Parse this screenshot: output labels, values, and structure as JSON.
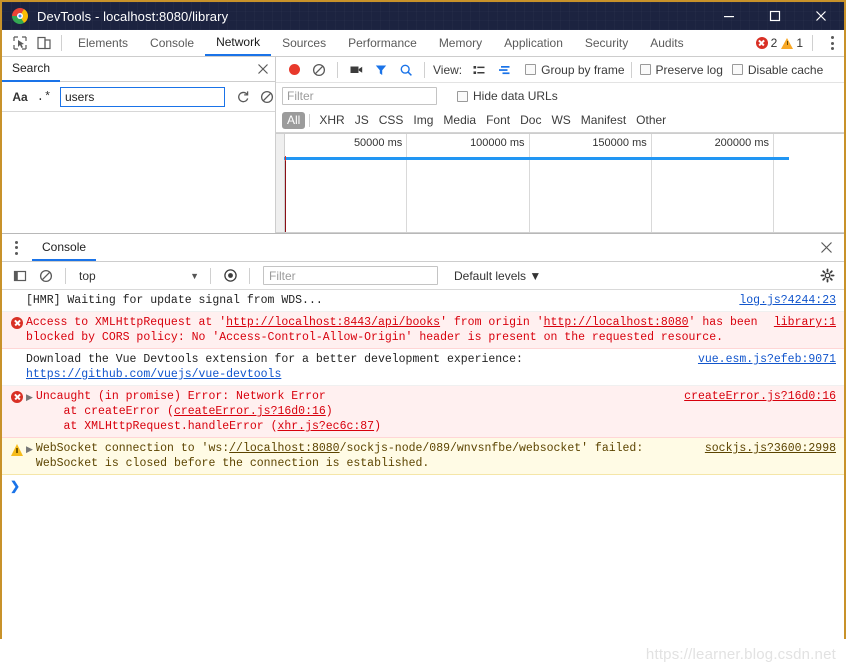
{
  "window": {
    "title": "DevTools - localhost:8080/library",
    "logo": "chrome-logo",
    "minimize": "–",
    "maximize": "□",
    "close": "✕"
  },
  "devtools_tabs": {
    "inspect_icon": "inspect-cursor-icon",
    "device_icon": "device-toolbar-icon",
    "items": [
      {
        "label": "Elements",
        "active": false
      },
      {
        "label": "Console",
        "active": false
      },
      {
        "label": "Network",
        "active": true
      },
      {
        "label": "Sources",
        "active": false
      },
      {
        "label": "Performance",
        "active": false
      },
      {
        "label": "Memory",
        "active": false
      },
      {
        "label": "Application",
        "active": false
      },
      {
        "label": "Security",
        "active": false
      },
      {
        "label": "Audits",
        "active": false
      }
    ],
    "error_count": "2",
    "warning_count": "1",
    "more_icon": "kebab-menu-icon"
  },
  "search_panel": {
    "tab_label": "Search",
    "close_icon": "close-icon",
    "match_case_label": "Aa",
    "regex_label": ".*",
    "query_value": "users",
    "refresh_icon": "refresh-icon",
    "clear_icon": "clear-icon"
  },
  "network": {
    "record_icon": "record-button",
    "clear_icon": "clear-icon",
    "camera_icon": "camera-icon",
    "filter_icon": "filter-icon",
    "search_icon": "search-icon",
    "view_label": "View:",
    "view_list_icon": "list-view-icon",
    "view_waterfall_icon": "waterfall-view-icon",
    "group_by_frame_label": "Group by frame",
    "preserve_log_label": "Preserve log",
    "disable_cache_label": "Disable cache",
    "filter_placeholder": "Filter",
    "filter_value": "",
    "hide_data_urls_label": "Hide data URLs",
    "types": [
      {
        "label": "All",
        "selected": true
      },
      {
        "label": "XHR",
        "selected": false
      },
      {
        "label": "JS",
        "selected": false
      },
      {
        "label": "CSS",
        "selected": false
      },
      {
        "label": "Img",
        "selected": false
      },
      {
        "label": "Media",
        "selected": false
      },
      {
        "label": "Font",
        "selected": false
      },
      {
        "label": "Doc",
        "selected": false
      },
      {
        "label": "WS",
        "selected": false
      },
      {
        "label": "Manifest",
        "selected": false
      },
      {
        "label": "Other",
        "selected": false
      }
    ],
    "timeline_ticks": [
      "50000 ms",
      "100000 ms",
      "150000 ms",
      "200000 ms"
    ]
  },
  "drawer": {
    "menu_icon": "kebab-menu-icon",
    "tab_label": "Console",
    "close_icon": "close-icon",
    "sidebar_icon": "console-sidebar-icon",
    "clear_icon": "clear-console-icon",
    "context_value": "top",
    "eye_icon": "live-expression-icon",
    "filter_placeholder": "Filter",
    "filter_value": "",
    "levels_label": "Default levels",
    "settings_icon": "settings-gear-icon",
    "prompt_caret": "❯"
  },
  "console_messages": [
    {
      "level": "info",
      "icon": "",
      "expander": false,
      "text": "[HMR] Waiting for update signal from WDS...",
      "source": "log.js?4244:23"
    },
    {
      "level": "error",
      "icon": "error-icon",
      "expander": false,
      "text": "Access to XMLHttpRequest at 'http://localhost:8443/api/books' from origin 'http://localhost:8080' has been blocked by CORS policy: No 'Access-Control-Allow-Origin' header is present on the requested resource.",
      "links": [
        "http://localhost:8443/api/books",
        "http://localhost:8080"
      ],
      "source": "library:1"
    },
    {
      "level": "info",
      "icon": "",
      "expander": false,
      "text": "Download the Vue Devtools extension for a better development experience:\nhttps://github.com/vuejs/vue-devtools",
      "links": [
        "https://github.com/vuejs/vue-devtools"
      ],
      "source": "vue.esm.js?efeb:9071"
    },
    {
      "level": "error",
      "icon": "error-icon",
      "expander": true,
      "text": "Uncaught (in promise) Error: Network Error\n    at createError (createError.js?16d0:16)\n    at XMLHttpRequest.handleError (xhr.js?ec6c:87)",
      "links": [
        "createError.js?16d0:16",
        "xhr.js?ec6c:87"
      ],
      "source": "createError.js?16d0:16"
    },
    {
      "level": "warn",
      "icon": "warning-icon",
      "expander": true,
      "text": "WebSocket connection to 'ws://localhost:8080/sockjs-node/089/wnvsnfbe/websocket' failed: WebSocket is closed before the connection is established.",
      "links": [
        "//localhost:8080"
      ],
      "source": "sockjs.js?3600:2998"
    }
  ],
  "watermark": "https://learner.blog.csdn.net"
}
